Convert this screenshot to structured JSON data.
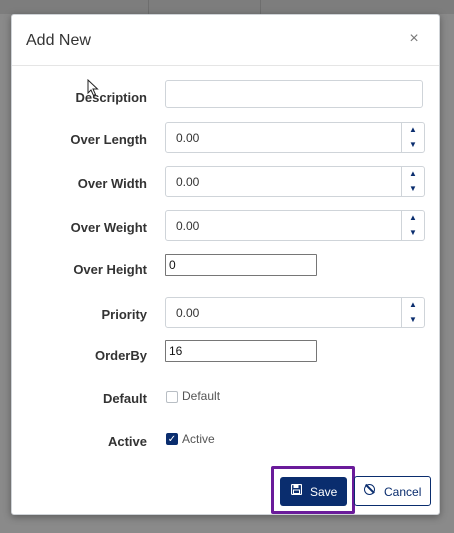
{
  "dialog": {
    "title": "Add New",
    "close_glyph": "×"
  },
  "fields": {
    "description": {
      "label": "Description",
      "value": ""
    },
    "over_length": {
      "label": "Over Length",
      "value": "0.00"
    },
    "over_width": {
      "label": "Over Width",
      "value": "0.00"
    },
    "over_weight": {
      "label": "Over Weight",
      "value": "0.00"
    },
    "over_height": {
      "label": "Over Height",
      "value": "0"
    },
    "priority": {
      "label": "Priority",
      "value": "0.00"
    },
    "order_by": {
      "label": "OrderBy",
      "value": "16"
    },
    "default": {
      "label": "Default",
      "checkbox_label": "Default",
      "checked": false
    },
    "active": {
      "label": "Active",
      "checkbox_label": "Active",
      "checked": true
    }
  },
  "spinner": {
    "up_glyph": "▲",
    "down_glyph": "▼"
  },
  "buttons": {
    "save_label": "Save",
    "cancel_label": "Cancel"
  },
  "icons": {
    "close": "close-icon",
    "save": "floppy-disk-icon",
    "cancel": "ban-icon",
    "spin_up": "caret-up-icon",
    "spin_down": "caret-down-icon",
    "check": "checkmark-icon"
  },
  "colors": {
    "primary": "#0a2d6e",
    "highlight_border": "#6a1b9a",
    "overlay": "#8a8a8a"
  }
}
